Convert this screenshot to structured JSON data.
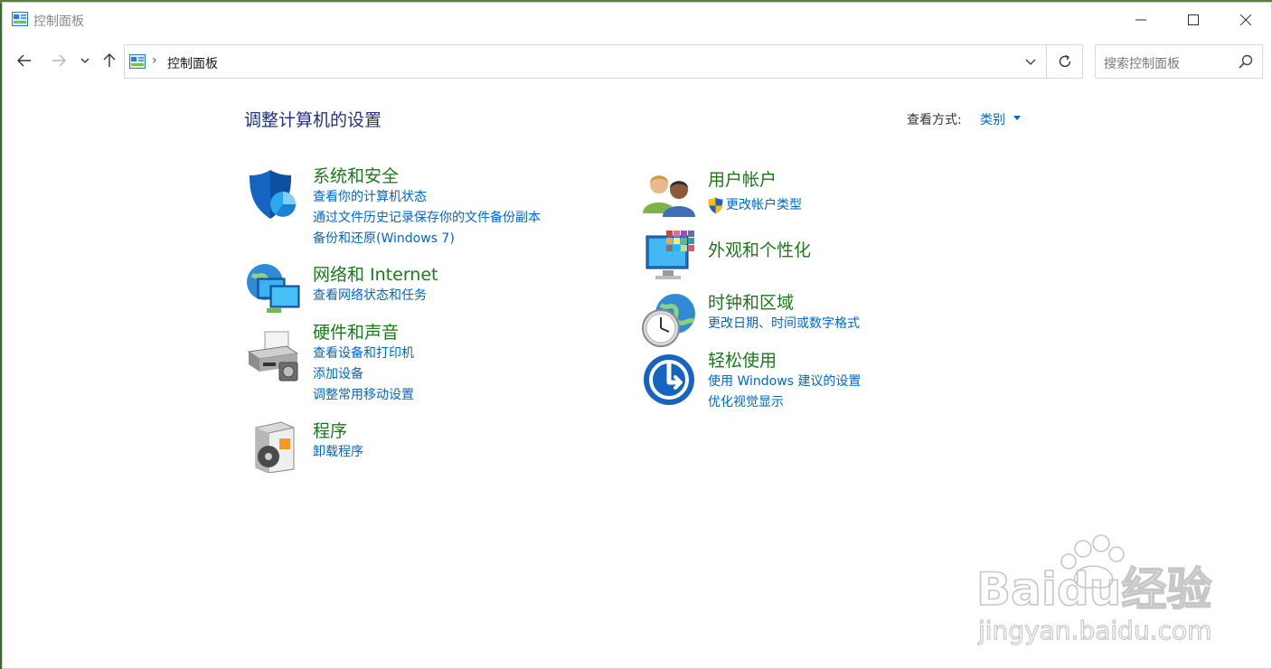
{
  "window": {
    "title": "控制面板"
  },
  "navbar": {
    "breadcrumb_separator": "›",
    "breadcrumb_location": "控制面板",
    "search_placeholder": "搜索控制面板"
  },
  "main": {
    "title": "调整计算机的设置",
    "view_by_label": "查看方式:",
    "view_by_value": "类别"
  },
  "categories_left": [
    {
      "title": "系统和安全",
      "icon": "shield-icon",
      "links": [
        "查看你的计算机状态",
        "通过文件历史记录保存你的文件备份副本",
        "备份和还原(Windows 7)"
      ]
    },
    {
      "title": "网络和 Internet",
      "icon": "network-icon",
      "links": [
        "查看网络状态和任务"
      ]
    },
    {
      "title": "硬件和声音",
      "icon": "printer-icon",
      "links": [
        "查看设备和打印机",
        "添加设备",
        "调整常用移动设置"
      ]
    },
    {
      "title": "程序",
      "icon": "programs-icon",
      "links": [
        "卸载程序"
      ]
    }
  ],
  "categories_right": [
    {
      "title": "用户帐户",
      "icon": "users-icon",
      "links": [
        "更改帐户类型"
      ]
    },
    {
      "title": "外观和个性化",
      "icon": "appearance-icon",
      "links": []
    },
    {
      "title": "时钟和区域",
      "icon": "clock-globe-icon",
      "links": [
        "更改日期、时间或数字格式"
      ]
    },
    {
      "title": "轻松使用",
      "icon": "ease-of-access-icon",
      "links": [
        "使用 Windows 建议的设置",
        "优化视觉显示"
      ]
    }
  ],
  "watermark": {
    "brand": "Baidu经验",
    "url": "jingyan.baidu.com"
  },
  "colors": {
    "title_blue": "#1e3287",
    "category_green": "#1a7a1a",
    "link_blue": "#0066cc"
  }
}
